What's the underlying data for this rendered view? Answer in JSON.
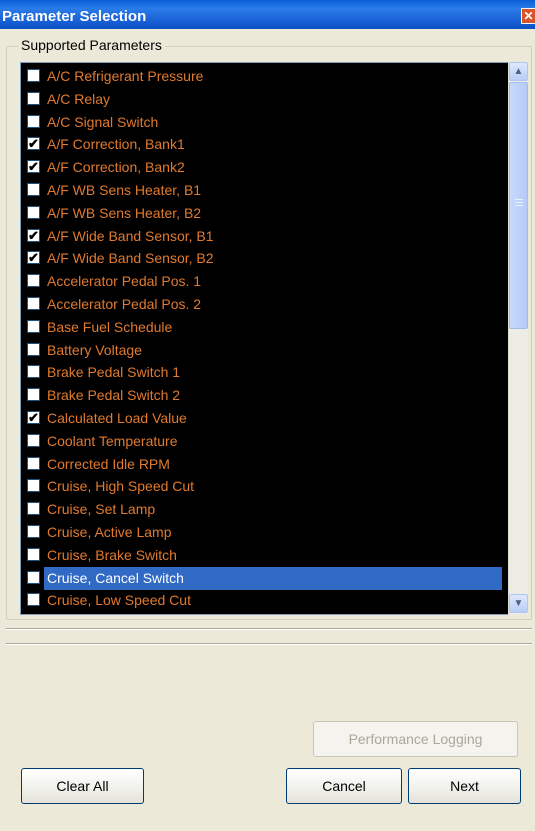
{
  "window": {
    "title": "Parameter Selection",
    "close_glyph": "✕"
  },
  "group": {
    "label": "Supported Parameters"
  },
  "parameters": [
    {
      "label": "A/C Refrigerant Pressure",
      "checked": false
    },
    {
      "label": "A/C Relay",
      "checked": false
    },
    {
      "label": "A/C Signal Switch",
      "checked": false
    },
    {
      "label": "A/F Correction, Bank1",
      "checked": true
    },
    {
      "label": "A/F Correction, Bank2",
      "checked": true
    },
    {
      "label": "A/F WB Sens Heater, B1",
      "checked": false
    },
    {
      "label": "A/F WB Sens Heater, B2",
      "checked": false
    },
    {
      "label": "A/F Wide Band Sensor, B1",
      "checked": true
    },
    {
      "label": "A/F Wide Band Sensor, B2",
      "checked": true
    },
    {
      "label": "Accelerator Pedal Pos. 1",
      "checked": false
    },
    {
      "label": "Accelerator Pedal Pos. 2",
      "checked": false
    },
    {
      "label": "Base Fuel Schedule",
      "checked": false
    },
    {
      "label": "Battery Voltage",
      "checked": false
    },
    {
      "label": "Brake Pedal Switch 1",
      "checked": false
    },
    {
      "label": "Brake Pedal Switch 2",
      "checked": false
    },
    {
      "label": "Calculated Load Value",
      "checked": true
    },
    {
      "label": "Coolant Temperature",
      "checked": false
    },
    {
      "label": "Corrected Idle RPM",
      "checked": false
    },
    {
      "label": "Cruise,  High Speed Cut",
      "checked": false
    },
    {
      "label": "Cruise,  Set Lamp",
      "checked": false
    },
    {
      "label": "Cruise, Active Lamp",
      "checked": false
    },
    {
      "label": "Cruise, Brake Switch",
      "checked": false
    },
    {
      "label": "Cruise, Cancel Switch",
      "checked": false,
      "selected": true
    },
    {
      "label": "Cruise, Low Speed Cut",
      "checked": false
    }
  ],
  "check_glyph": "✔",
  "scrollbar": {
    "up_glyph": "▲",
    "down_glyph": "▼"
  },
  "buttons": {
    "performance_logging": "Performance Logging",
    "clear_all": "Clear All",
    "cancel": "Cancel",
    "next": "Next"
  },
  "colors": {
    "item_text": "#e07a2e",
    "list_bg": "#000000",
    "selection": "#316ac5"
  }
}
